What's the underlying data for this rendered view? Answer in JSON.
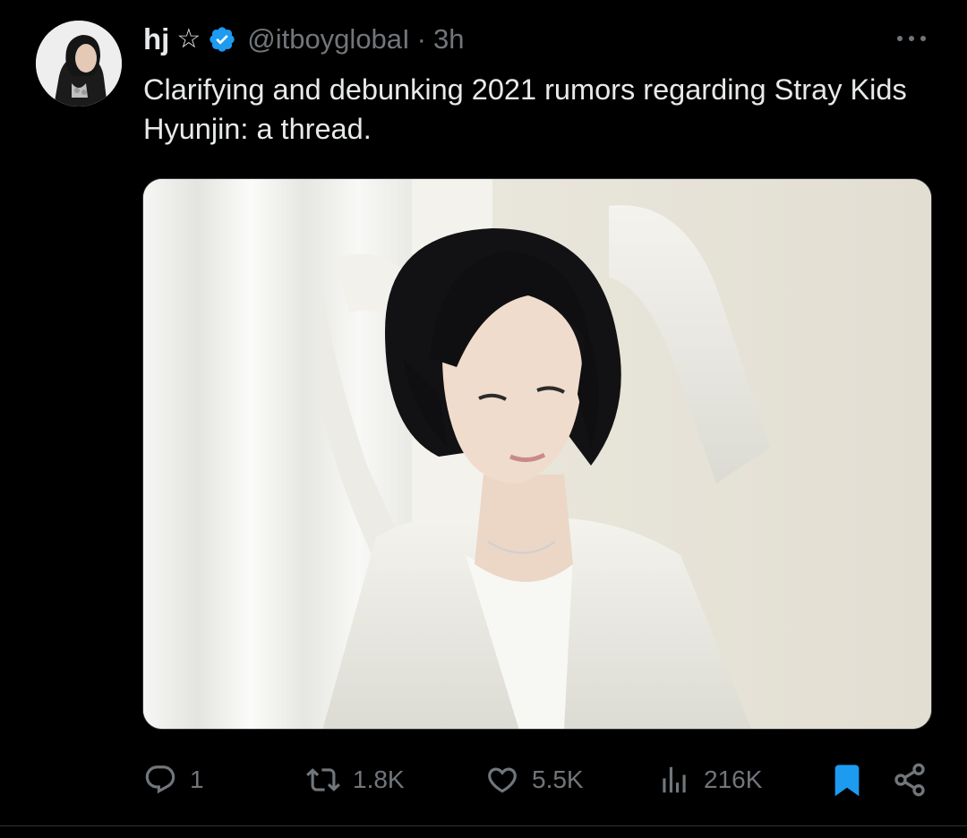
{
  "author": {
    "display_name": "hj",
    "name_symbol": "☆",
    "handle": "@itboyglobaI",
    "separator": "·",
    "time": "3h",
    "verified": true
  },
  "tweet": {
    "text": "Clarifying and debunking 2021 rumors regarding Stray Kids Hyunjin: a thread."
  },
  "actions": {
    "reply_count": "1",
    "retweet_count": "1.8K",
    "like_count": "5.5K",
    "view_count": "216K"
  },
  "icons": {
    "more": "more-horizontal-icon",
    "reply": "reply-icon",
    "retweet": "retweet-icon",
    "like": "heart-icon",
    "views": "views-icon",
    "bookmark": "bookmark-icon",
    "share": "share-icon",
    "verified": "verified-badge-icon"
  },
  "colors": {
    "background": "#000000",
    "text": "#e7e9ea",
    "muted": "#71767b",
    "accent": "#1d9bf0"
  }
}
